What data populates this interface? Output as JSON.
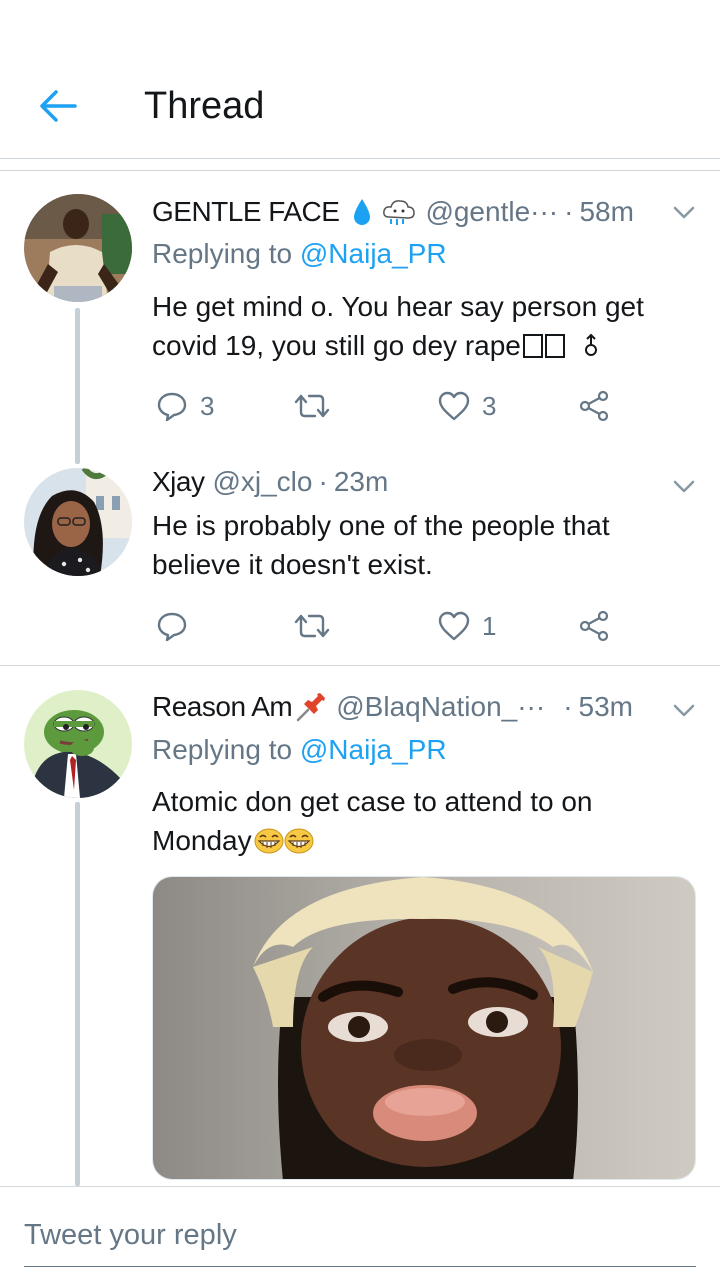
{
  "header": {
    "title": "Thread"
  },
  "tweets": [
    {
      "name": "GENTLE FACE",
      "handle": "@gentle···",
      "dot": "·",
      "time": "58m",
      "replying_prefix": "Replying to ",
      "replying_to": "@Naija_PR",
      "text_line1": "He get mind o. You hear say person get",
      "text_line2": "covid 19, you still go dey rape",
      "reply_count": "3",
      "retweet_count": "",
      "like_count": "3"
    },
    {
      "name": "Xjay",
      "handle": "@xj_clo",
      "dot": "·",
      "time": "23m",
      "text_line1": "He is probably one of the people that",
      "text_line2": "believe it doesn't exist.",
      "reply_count": "",
      "retweet_count": "",
      "like_count": "1"
    },
    {
      "name": "Reason Am",
      "handle": "@BlaqNation_···",
      "dot": "·",
      "time": "53m",
      "replying_prefix": "Replying to ",
      "replying_to": "@Naija_PR",
      "text_line1": "Atomic don get case to attend to on",
      "text_line2": "Monday"
    }
  ],
  "footer": {
    "reply_placeholder": "Tweet your reply"
  },
  "colors": {
    "accent": "#1da1f2",
    "secondary_text": "#657786",
    "primary_text": "#14171a"
  },
  "icons": [
    "back-arrow-icon",
    "droplet-icon",
    "cloud-icon",
    "pin-icon",
    "chevron-down-icon",
    "reply-icon",
    "retweet-icon",
    "heart-icon",
    "share-icon",
    "grinning-emoji-icon"
  ]
}
